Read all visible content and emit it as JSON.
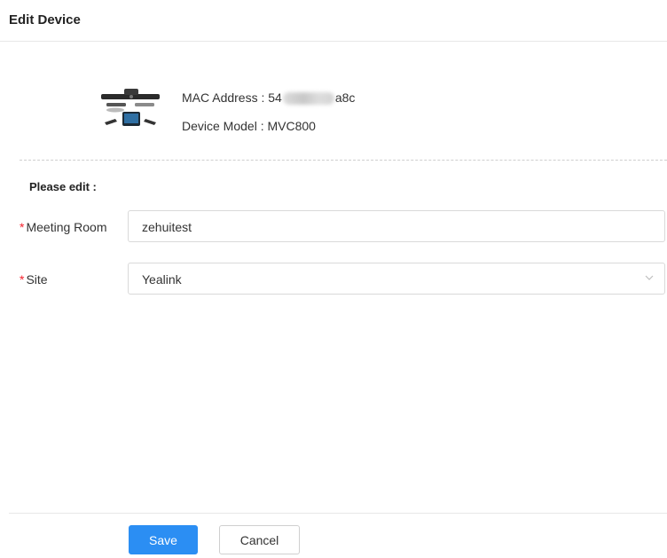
{
  "header": {
    "title": "Edit Device"
  },
  "device": {
    "image_icon": "video-conferencing-device",
    "mac_label": "MAC Address : ",
    "mac_prefix": "54",
    "mac_suffix": "a8c",
    "model_label": "Device Model : ",
    "model_value": "MVC800"
  },
  "form": {
    "section_title": "Please edit :",
    "required_mark": "*",
    "meeting_room": {
      "label": "Meeting Room",
      "value": "zehuitest"
    },
    "site": {
      "label": "Site",
      "value": "Yealink",
      "icon": "chevron-down-icon"
    }
  },
  "footer": {
    "save_label": "Save",
    "cancel_label": "Cancel"
  },
  "colors": {
    "primary": "#2b8ef3",
    "required": "#f5222d",
    "border": "#d9d9d9"
  }
}
